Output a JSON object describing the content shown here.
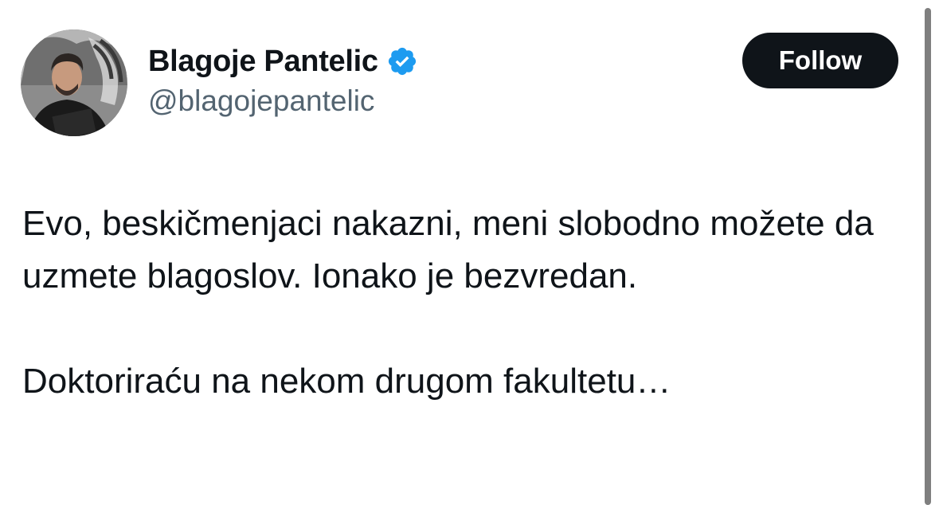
{
  "author": {
    "display_name": "Blagoje Pantelic",
    "handle": "@blagojepantelic",
    "verified": true,
    "avatar": "profile-photo"
  },
  "follow_button": {
    "label": "Follow"
  },
  "tweet": {
    "paragraph_1": "Evo, beskičmenjaci nakazni, meni slobodno možete da uzmete blagoslov. Ionako je bezvredan.",
    "paragraph_2": "Doktoriraću na nekom drugom fakultetu…"
  },
  "colors": {
    "text_primary": "#0f1419",
    "text_secondary": "#536471",
    "verified_badge": "#1d9bf0",
    "follow_button_bg": "#0f1419",
    "follow_button_text": "#ffffff"
  },
  "icons": {
    "verified": "verified-badge-icon"
  }
}
